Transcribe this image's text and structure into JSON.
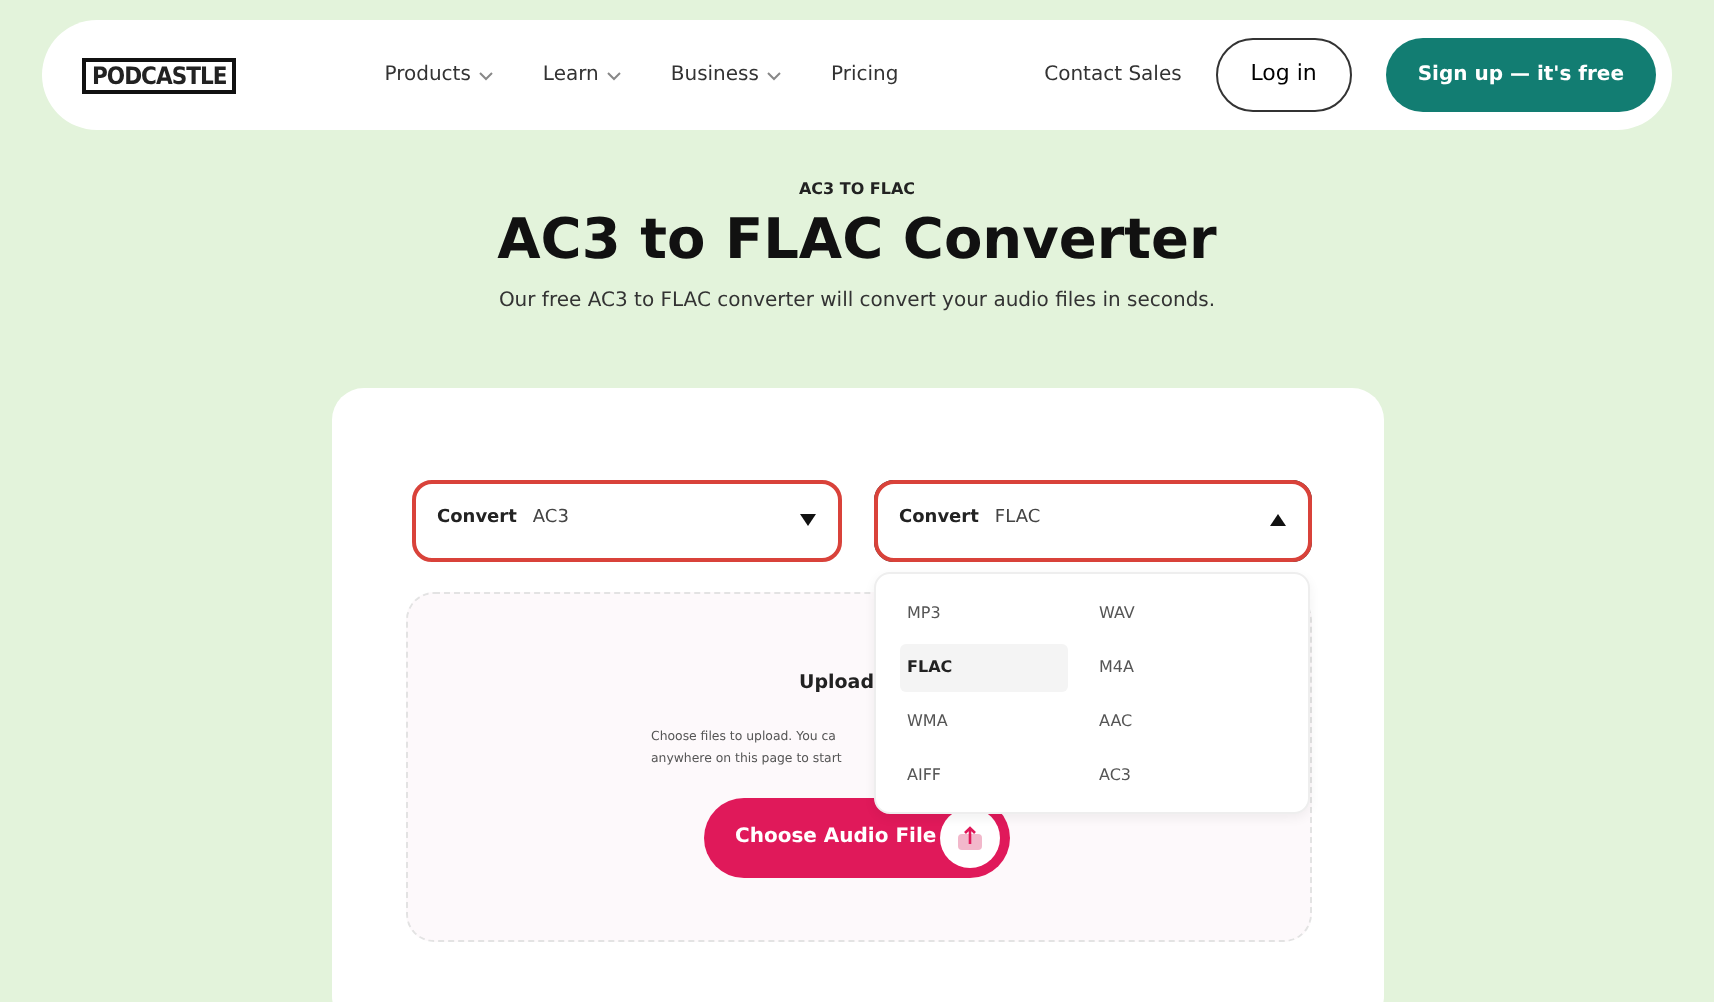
{
  "nav": {
    "logo": "PODCASTLE",
    "links": [
      {
        "label": "Products",
        "dropdown": true
      },
      {
        "label": "Learn",
        "dropdown": true
      },
      {
        "label": "Business",
        "dropdown": true
      },
      {
        "label": "Pricing",
        "dropdown": false
      }
    ],
    "contact": "Contact Sales",
    "login": "Log in",
    "signup": "Sign up — it's free"
  },
  "hero": {
    "eyebrow": "AC3 TO FLAC",
    "title": "AC3 to FLAC Converter",
    "subtitle": "Our free AC3 to FLAC converter will convert your audio files in seconds."
  },
  "selects": [
    {
      "label": "Convert",
      "value": "AC3",
      "expanded": false,
      "highlighted": true
    },
    {
      "label": "Convert",
      "value": "FLAC",
      "expanded": true,
      "highlighted": true
    }
  ],
  "dropdown_options": [
    {
      "label": "MP3",
      "selected": false
    },
    {
      "label": "WAV",
      "selected": false
    },
    {
      "label": "FLAC",
      "selected": true
    },
    {
      "label": "M4A",
      "selected": false
    },
    {
      "label": "WMA",
      "selected": false
    },
    {
      "label": "AAC",
      "selected": false
    },
    {
      "label": "AIFF",
      "selected": false
    },
    {
      "label": "AC3",
      "selected": false
    }
  ],
  "upload": {
    "title": "Upload",
    "text_lines": [
      "Choose files to upload. You ca",
      "anywhere on this page to start"
    ],
    "button": "Choose Audio File"
  }
}
